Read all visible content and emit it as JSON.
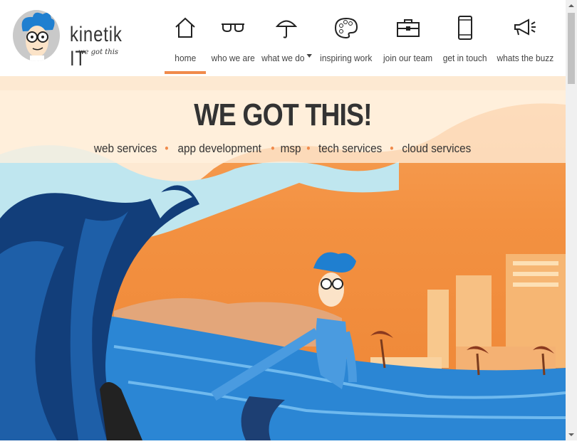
{
  "brand": {
    "name": "kinetik IT",
    "tagline": "we got this"
  },
  "nav": {
    "items": [
      {
        "label": "home",
        "icon": "home-icon",
        "active": true
      },
      {
        "label": "who we are",
        "icon": "glasses-icon",
        "active": false
      },
      {
        "label": "what we do",
        "icon": "umbrella-icon",
        "active": false,
        "dropdown": true
      },
      {
        "label": "inspiring work",
        "icon": "palette-icon",
        "active": false
      },
      {
        "label": "join our team",
        "icon": "briefcase-icon",
        "active": false
      },
      {
        "label": "get in touch",
        "icon": "phone-icon",
        "active": false
      },
      {
        "label": "whats the buzz",
        "icon": "megaphone-icon",
        "active": false
      }
    ]
  },
  "hero": {
    "title": "WE GOT THIS!",
    "services": [
      "web services",
      "app development",
      "msp",
      "tech services",
      "cloud services"
    ]
  },
  "colors": {
    "accent": "#f08a4b",
    "text": "#333333",
    "wave_dark": "#0f4f8c",
    "wave_light": "#2f8fd8"
  }
}
